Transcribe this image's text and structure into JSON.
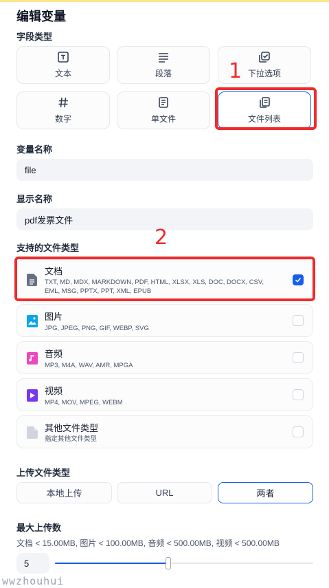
{
  "title": "编辑变量",
  "field_type": {
    "label": "字段类型",
    "options": [
      {
        "label": "文本",
        "icon": "text-box-icon"
      },
      {
        "label": "段落",
        "icon": "paragraph-icon"
      },
      {
        "label": "下拉选项",
        "icon": "select-check-icon"
      },
      {
        "label": "数字",
        "icon": "hash-icon"
      },
      {
        "label": "单文件",
        "icon": "file-icon"
      },
      {
        "label": "文件列表",
        "icon": "file-list-icon",
        "selected": true
      }
    ]
  },
  "variable_name": {
    "label": "变量名称",
    "value": "file"
  },
  "display_name": {
    "label": "显示名称",
    "value": "pdf发票文件"
  },
  "supported_types": {
    "label": "支持的文件类型",
    "items": [
      {
        "name": "文档",
        "exts_line1": "TXT, MD, MDX, MARKDOWN, PDF, HTML, XLSX, XLS, DOC, DOCX, CSV,",
        "exts_line2": "EML, MSG, PPTX, PPT, XML, EPUB",
        "checked": true,
        "icon": "document-icon",
        "color": "#667085"
      },
      {
        "name": "图片",
        "exts_line1": "JPG, JPEG, PNG, GIF, WEBP, SVG",
        "checked": false,
        "icon": "image-icon",
        "color": "#0ba5ec"
      },
      {
        "name": "音频",
        "exts_line1": "MP3, M4A, WAV, AMR, MPGA",
        "checked": false,
        "icon": "audio-icon",
        "color": "#ee46bc"
      },
      {
        "name": "视频",
        "exts_line1": "MP4, MOV, MPEG, WEBM",
        "checked": false,
        "icon": "video-icon",
        "color": "#7839ee"
      },
      {
        "name": "其他文件类型",
        "exts_line1": "指定其他文件类型",
        "checked": false,
        "icon": "other-file-icon",
        "color": "#d0d5dd"
      }
    ]
  },
  "upload_type": {
    "label": "上传文件类型",
    "options": [
      "本地上传",
      "URL",
      "两者"
    ],
    "selected": "两者"
  },
  "max_uploads": {
    "label": "最大上传数",
    "limits": "文档 < 15.00MB, 图片 < 100.00MB, 音频 < 500.00MB, 视频 < 500.00MB",
    "value": "5",
    "slider_fraction": 0.44
  },
  "annotations": {
    "one": "1",
    "two": "2"
  },
  "watermark": "wwzhouhui",
  "colors": {
    "accent": "#155eef",
    "annotation": "#ef2b2b"
  }
}
